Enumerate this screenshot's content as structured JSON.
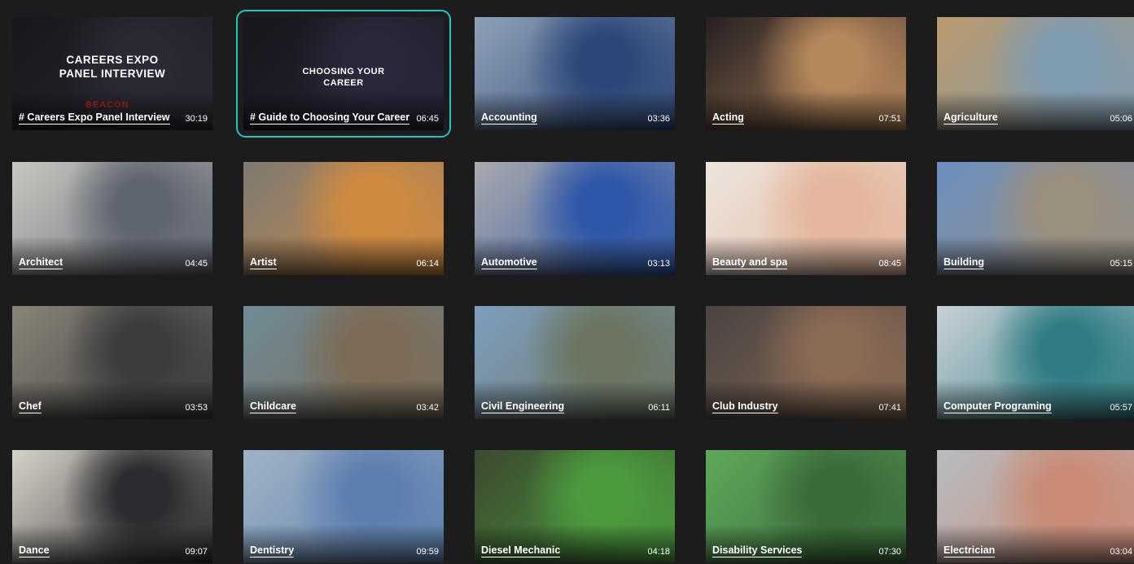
{
  "videos": [
    {
      "title": "# Careers Expo Panel Interview",
      "duration": "30:19",
      "overlay": "CAREERS EXPO\nPANEL INTERVIEW",
      "overlay_sub": "BEACON",
      "bg": "#17171c",
      "accent": "#2a2a34"
    },
    {
      "title": "# Guide to Choosing Your Career",
      "duration": "06:45",
      "overlay": "CHOOSING YOUR\nCAREER",
      "bg": "#16161b",
      "accent": "#28283a",
      "selected": true
    },
    {
      "title": "Accounting",
      "duration": "03:36",
      "bg": "#8ea0b6",
      "accent": "#2d4778"
    },
    {
      "title": "Acting",
      "duration": "07:51",
      "bg": "#262022",
      "accent": "#b5875c"
    },
    {
      "title": "Agriculture",
      "duration": "05:06",
      "bg": "#b99a6d",
      "accent": "#7f9bb0"
    },
    {
      "title": "Architect",
      "duration": "04:45",
      "bg": "#c8c7c0",
      "accent": "#5f6570"
    },
    {
      "title": "Artist",
      "duration": "06:14",
      "bg": "#7e7a73",
      "accent": "#d08a3f"
    },
    {
      "title": "Automotive",
      "duration": "03:13",
      "bg": "#a8a9ab",
      "accent": "#2f57a9"
    },
    {
      "title": "Beauty and spa",
      "duration": "08:45",
      "bg": "#ece5dd",
      "accent": "#e4b69d"
    },
    {
      "title": "Building",
      "duration": "05:15",
      "bg": "#6b8fbf",
      "accent": "#9b8f7e"
    },
    {
      "title": "Chef",
      "duration": "03:53",
      "bg": "#8a8478",
      "accent": "#3c3c3e"
    },
    {
      "title": "Childcare",
      "duration": "03:42",
      "bg": "#6f8b96",
      "accent": "#7c6b55"
    },
    {
      "title": "Civil Engineering",
      "duration": "06:11",
      "bg": "#7e9ebf",
      "accent": "#6b7560"
    },
    {
      "title": "Club Industry",
      "duration": "07:41",
      "bg": "#4a4443",
      "accent": "#8a6b55"
    },
    {
      "title": "Computer Programing",
      "duration": "05:57",
      "bg": "#c8d0d6",
      "accent": "#2f7d83"
    },
    {
      "title": "Dance",
      "duration": "09:07",
      "bg": "#d7d2c8",
      "accent": "#2c2c30"
    },
    {
      "title": "Dentistry",
      "duration": "09:59",
      "bg": "#9fb3c4",
      "accent": "#5d7fb0"
    },
    {
      "title": "Diesel Mechanic",
      "duration": "04:18",
      "bg": "#3c4a2f",
      "accent": "#4c9b3f"
    },
    {
      "title": "Disability Services",
      "duration": "07:30",
      "bg": "#5fa75a",
      "accent": "#3a6b3a"
    },
    {
      "title": "Electrician",
      "duration": "03:04",
      "bg": "#b7bcc0",
      "accent": "#c98b76"
    }
  ]
}
